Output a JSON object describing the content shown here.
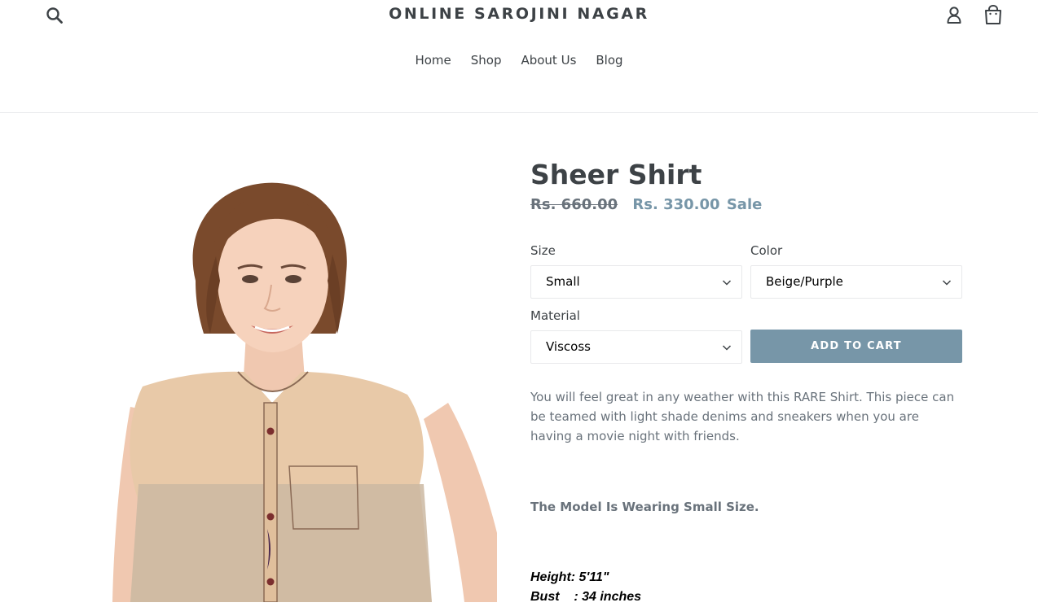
{
  "header": {
    "store_name": "ONLINE SAROJINI NAGAR",
    "nav": [
      "Home",
      "Shop",
      "About Us",
      "Blog"
    ],
    "icons": [
      "search-icon",
      "account-icon",
      "cart-icon"
    ]
  },
  "product": {
    "title": "Sheer Shirt",
    "price_regular": "Rs. 660.00",
    "price_sale": "Rs. 330.00",
    "sale_label": "Sale",
    "options": {
      "size": {
        "label": "Size",
        "value": "Small"
      },
      "color": {
        "label": "Color",
        "value": "Beige/Purple"
      },
      "material": {
        "label": "Material",
        "value": "Viscoss"
      }
    },
    "add_to_cart_label": "ADD TO CART",
    "description": "You will feel great in any weather with this RARE Shirt. This piece can be teamed with light shade denims and sneakers when you are having a movie night with friends.",
    "model_note": "The Model Is Wearing Small Size.",
    "measurements": {
      "height": "Height: 5'11\"",
      "bust": "Bust    : 34 inches"
    }
  },
  "colors": {
    "accent": "#7796a8",
    "text": "#3d4246",
    "muted": "#69727b",
    "border": "#e8e9eb"
  }
}
